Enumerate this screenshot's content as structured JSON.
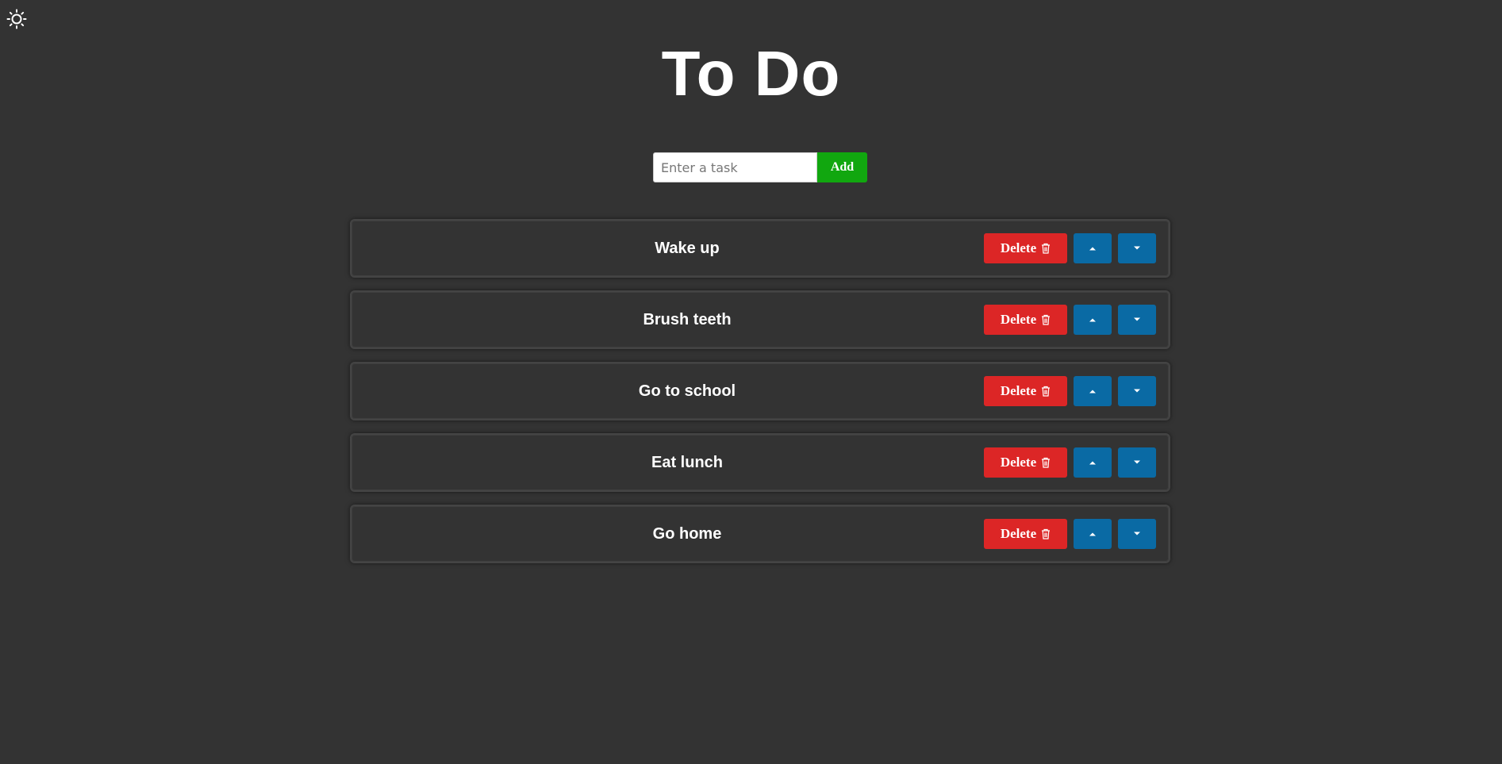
{
  "header": {
    "theme_toggle_icon": "sun-icon",
    "title": "To Do"
  },
  "add_form": {
    "placeholder": "Enter a task",
    "value": "",
    "add_label": "Add"
  },
  "colors": {
    "background": "#333333",
    "add_button": "#11a70f",
    "delete_button": "#dc2626",
    "move_button": "#0a6aa4"
  },
  "tasks": [
    {
      "text": "Wake up",
      "delete_label": "Delete",
      "delete_icon": "trash-icon",
      "up_icon": "caret-up-icon",
      "down_icon": "caret-down-icon"
    },
    {
      "text": "Brush teeth",
      "delete_label": "Delete",
      "delete_icon": "trash-icon",
      "up_icon": "caret-up-icon",
      "down_icon": "caret-down-icon"
    },
    {
      "text": "Go to school",
      "delete_label": "Delete",
      "delete_icon": "trash-icon",
      "up_icon": "caret-up-icon",
      "down_icon": "caret-down-icon"
    },
    {
      "text": "Eat lunch",
      "delete_label": "Delete",
      "delete_icon": "trash-icon",
      "up_icon": "caret-up-icon",
      "down_icon": "caret-down-icon"
    },
    {
      "text": "Go home",
      "delete_label": "Delete",
      "delete_icon": "trash-icon",
      "up_icon": "caret-up-icon",
      "down_icon": "caret-down-icon"
    }
  ]
}
